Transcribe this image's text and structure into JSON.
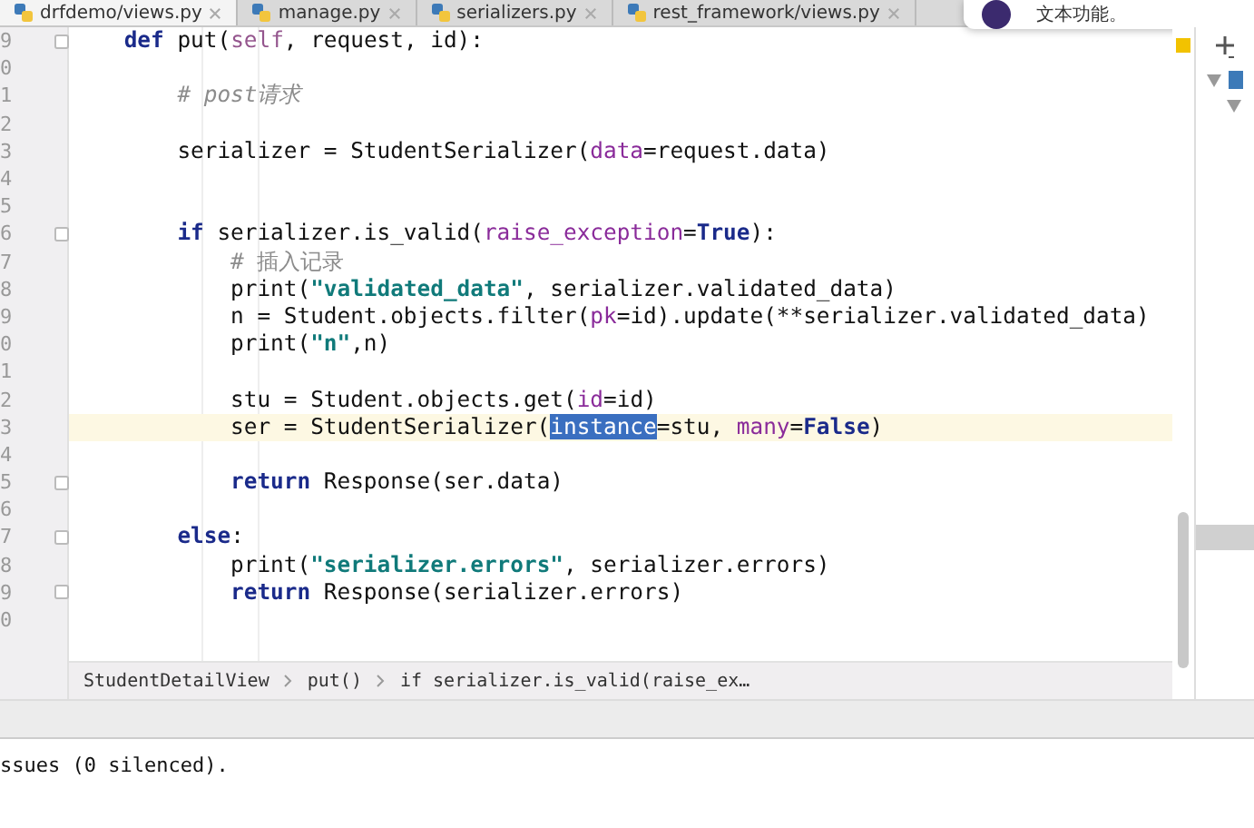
{
  "tabs": [
    {
      "label": "drfdemo/views.py",
      "selected": true
    },
    {
      "label": "manage.py",
      "selected": false
    },
    {
      "label": "serializers.py",
      "selected": false
    },
    {
      "label": "rest_framework/views.py",
      "selected": false
    }
  ],
  "notification": {
    "text": "文本功能。"
  },
  "editor": {
    "lines": [
      {
        "number": "9",
        "fold": true,
        "current": false,
        "tokens": [
          {
            "kind": "kw",
            "text": "    def"
          },
          {
            "kind": "plain",
            "text": " put("
          },
          {
            "kind": "self",
            "text": "self"
          },
          {
            "kind": "plain",
            "text": ", request, id):"
          }
        ]
      },
      {
        "number": "0",
        "fold": false,
        "current": false
      },
      {
        "number": "1",
        "fold": false,
        "current": false,
        "tokens": [
          {
            "kind": "comment",
            "text": "        # post请求"
          }
        ]
      },
      {
        "number": "2",
        "fold": false,
        "current": false
      },
      {
        "number": "3",
        "fold": false,
        "current": false,
        "tokens": [
          {
            "kind": "plain",
            "text": "        serializer = StudentSerializer("
          },
          {
            "kind": "param",
            "text": "data"
          },
          {
            "kind": "plain",
            "text": "=request.data)"
          }
        ]
      },
      {
        "number": "4",
        "fold": false,
        "current": false
      },
      {
        "number": "5",
        "fold": false,
        "current": false
      },
      {
        "number": "6",
        "fold": true,
        "current": false,
        "tokens": [
          {
            "kind": "kw",
            "text": "        if"
          },
          {
            "kind": "plain",
            "text": " serializer.is_valid("
          },
          {
            "kind": "param",
            "text": "raise_exception"
          },
          {
            "kind": "plain",
            "text": "="
          },
          {
            "kind": "kw",
            "text": "True"
          },
          {
            "kind": "plain",
            "text": "):"
          }
        ]
      },
      {
        "number": "7",
        "fold": false,
        "current": false,
        "tokens": [
          {
            "kind": "comment2",
            "text": "            # 插入记录"
          }
        ]
      },
      {
        "number": "8",
        "fold": false,
        "current": false,
        "tokens": [
          {
            "kind": "plain",
            "text": "            print("
          },
          {
            "kind": "str",
            "text": "\"validated_data\""
          },
          {
            "kind": "plain",
            "text": ", serializer.validated_data)"
          }
        ]
      },
      {
        "number": "9",
        "fold": false,
        "current": false,
        "tokens": [
          {
            "kind": "plain",
            "text": "            n = Student.objects.filter("
          },
          {
            "kind": "param",
            "text": "pk"
          },
          {
            "kind": "plain",
            "text": "=id).update(**serializer.validated_data)"
          }
        ]
      },
      {
        "number": "0",
        "fold": false,
        "current": false,
        "tokens": [
          {
            "kind": "plain",
            "text": "            print("
          },
          {
            "kind": "str",
            "text": "\"n\""
          },
          {
            "kind": "plain",
            "text": ",n)"
          }
        ]
      },
      {
        "number": "1",
        "fold": false,
        "current": false
      },
      {
        "number": "2",
        "fold": false,
        "current": false,
        "tokens": [
          {
            "kind": "plain",
            "text": "            stu = Student.objects.get("
          },
          {
            "kind": "param",
            "text": "id"
          },
          {
            "kind": "plain",
            "text": "=id)"
          }
        ]
      },
      {
        "number": "3",
        "fold": false,
        "current": true,
        "tokens": [
          {
            "kind": "plain",
            "text": "            ser = StudentSerializer("
          },
          {
            "kind": "selection",
            "text": "instance"
          },
          {
            "kind": "plain",
            "text": "=stu, "
          },
          {
            "kind": "param",
            "text": "many"
          },
          {
            "kind": "plain",
            "text": "="
          },
          {
            "kind": "kw",
            "text": "False"
          },
          {
            "kind": "plain",
            "text": ")"
          }
        ]
      },
      {
        "number": "4",
        "fold": false,
        "current": false
      },
      {
        "number": "5",
        "fold": true,
        "current": false,
        "tokens": [
          {
            "kind": "kw",
            "text": "            return"
          },
          {
            "kind": "plain",
            "text": " Response(ser.data)"
          }
        ]
      },
      {
        "number": "6",
        "fold": false,
        "current": false
      },
      {
        "number": "7",
        "fold": true,
        "current": false,
        "tokens": [
          {
            "kind": "kw",
            "text": "        else"
          },
          {
            "kind": "plain",
            "text": ":"
          }
        ]
      },
      {
        "number": "8",
        "fold": false,
        "current": false,
        "tokens": [
          {
            "kind": "plain",
            "text": "            print("
          },
          {
            "kind": "str",
            "text": "\"serializer.errors\""
          },
          {
            "kind": "plain",
            "text": ", serializer.errors)"
          }
        ]
      },
      {
        "number": "9",
        "fold": true,
        "current": false,
        "tokens": [
          {
            "kind": "kw",
            "text": "            return"
          },
          {
            "kind": "plain",
            "text": " Response(serializer.errors)"
          }
        ]
      },
      {
        "number": "0",
        "fold": false,
        "current": false
      }
    ]
  },
  "breadcrumbs": [
    "StudentDetailView",
    "put()",
    "if serializer.is_valid(raise_ex…"
  ],
  "console": {
    "text": "ssues (0 silenced)."
  }
}
